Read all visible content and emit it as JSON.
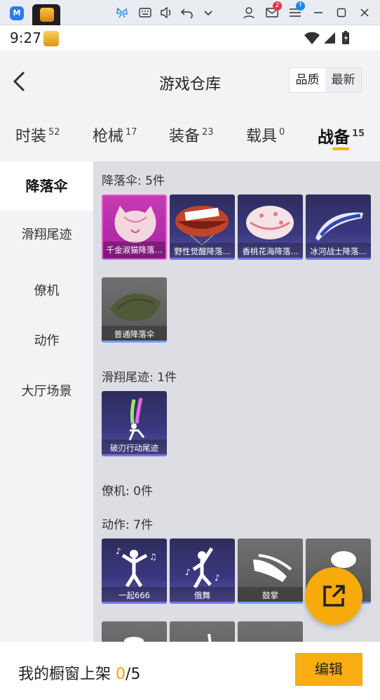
{
  "emulator": {
    "logo_text": "M",
    "mail_badge": "2",
    "icons": [
      "butterfly-icon",
      "keyboard-icon",
      "volume-icon",
      "undo-icon",
      "chevron-down-icon",
      "user-icon",
      "mail-icon",
      "menu-icon",
      "minimize-icon",
      "maximize-icon",
      "close-icon"
    ]
  },
  "status": {
    "time": "9:27"
  },
  "header": {
    "title": "游戏仓库",
    "sort_options": [
      "品质",
      "最新"
    ],
    "sort_selected": "品质"
  },
  "tabs": [
    {
      "label": "时装",
      "count": "52"
    },
    {
      "label": "枪械",
      "count": "17"
    },
    {
      "label": "装备",
      "count": "23"
    },
    {
      "label": "载具",
      "count": "0"
    },
    {
      "label": "战备",
      "count": "15",
      "active": true
    }
  ],
  "sidenav": [
    "降落伞",
    "滑翔尾迹",
    "僚机",
    "动作",
    "大厅场景"
  ],
  "sections": {
    "parachute": {
      "title": "降落伞: 5件",
      "items": [
        "千金淑猫降落...",
        "野性觉醒降落...",
        "香桃花海降落...",
        "冰河战士降落...",
        "普通降落伞"
      ]
    },
    "trail": {
      "title": "滑翔尾迹: 1件",
      "items": [
        "破刃行动尾迹"
      ]
    },
    "wingman": {
      "title": "僚机: 0件"
    },
    "emote": {
      "title": "动作: 7件",
      "items": [
        "一起666",
        "俄舞",
        "鼓掌"
      ]
    }
  },
  "bottom": {
    "showcase_label": "我的橱窗上架",
    "showcase_current": "0",
    "showcase_sep": "/",
    "showcase_max": "5",
    "edit_label": "编辑"
  },
  "colors": {
    "accent": "#f8ad12",
    "count_highlight": "#f0a800",
    "rare_pink": "#c53bb1",
    "epic_purple": "#3a3880"
  }
}
